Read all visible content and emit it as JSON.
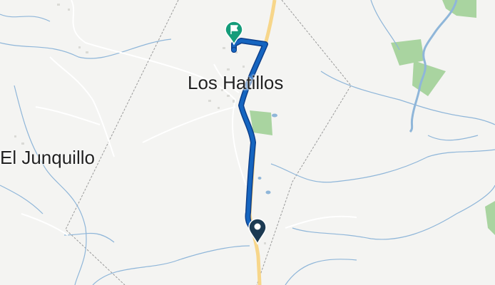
{
  "map": {
    "places": [
      {
        "name": "Los Hatillos"
      },
      {
        "name": "El Junquillo"
      }
    ],
    "route": {
      "color": "#1565c0",
      "start_marker_icon": "location-pin-icon",
      "start_marker_color": "#1c3a52",
      "end_marker_icon": "flag-icon",
      "end_marker_color": "#159c7a"
    },
    "colors": {
      "background": "#f4f4f2",
      "water": "#8fb6d9",
      "park": "#a9d4a0",
      "road_major": "#f7d68a",
      "road_minor": "#ffffff",
      "boundary": "#9a9a9a"
    }
  }
}
